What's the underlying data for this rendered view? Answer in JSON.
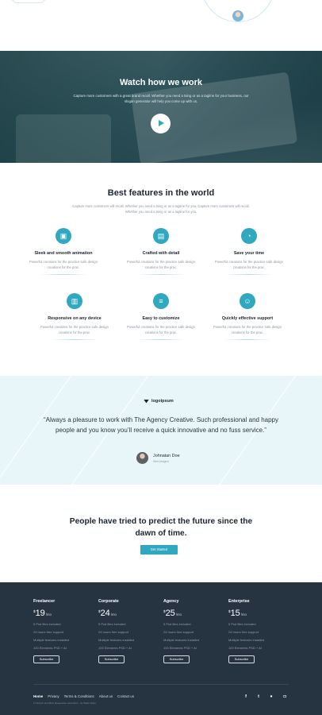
{
  "video": {
    "title": "Watch how we work",
    "subtitle": "Capture more customers with a great brand recall. Whether you need a tsing or as a tagline for your business, our slogan generator will help you come up with us."
  },
  "features": {
    "title": "Best features in the world",
    "subtitle": "Capture more customers will recall. Whether you need a tsing or as a tagline for you. Capture more customers will recall. Whether you need a tsing or as a tagline for you.",
    "items": [
      {
        "title": "Sleek and smooth animation",
        "desc": "Powerful creations for the practice safe design creations for the prac."
      },
      {
        "title": "Crafted with detail",
        "desc": "Powerful creations for the practice safe design creations for the prac."
      },
      {
        "title": "Save your time",
        "desc": "Powerful creations for the practice safe design creations for the prac."
      },
      {
        "title": "Responsive on any device",
        "desc": "Powerful creations for the practice safe design creations for the prac."
      },
      {
        "title": "Easy to customize",
        "desc": "Powerful creations for the practice safe design creations for the prac."
      },
      {
        "title": "Quickly effective support",
        "desc": "Powerful creations for the practice safe design creations for the prac."
      }
    ]
  },
  "testimonial": {
    "logo": "logoipsum",
    "quote": "“Always a pleasure to work with The Agency Creative. Such professional and happy people and you know you’ll receive a quick innovative and no fuss service.”",
    "author_name": "Johnatan Doe",
    "author_role": "Web Designer"
  },
  "cta": {
    "title": "People have tried to predict the future since the dawn of time.",
    "button": "Get Started"
  },
  "pricing": [
    {
      "name": "Freelancer",
      "currency": "$",
      "amount": "19",
      "period": "/mo",
      "features": [
        "5 Psd files included",
        "24 hours free support",
        "Multiple features installed",
        "100 Elements PSD + AI"
      ],
      "button": "Subscribe"
    },
    {
      "name": "Corporate",
      "currency": "$",
      "amount": "24",
      "period": "/mo",
      "features": [
        "5 Psd files included",
        "24 hours free support",
        "Multiple features installed",
        "100 Elements PSD + AI"
      ],
      "button": "Subscribe"
    },
    {
      "name": "Agency",
      "currency": "$",
      "amount": "25",
      "period": "/mo",
      "features": [
        "5 Psd files included",
        "24 hours free support",
        "Multiple features installed",
        "100 Elements PSD + AI"
      ],
      "button": "Subscribe"
    },
    {
      "name": "Enterprise",
      "currency": "$",
      "amount": "15",
      "period": "/mo",
      "features": [
        "5 Psd files included",
        "24 hours free support",
        "Multiple features installed",
        "100 Elements PSD + AI"
      ],
      "button": "Subscribe"
    }
  ],
  "footer": {
    "nav": [
      "Home",
      "Privacy",
      "Terms & Conditions",
      "About us",
      "Contact us"
    ],
    "copyright": "© Fintech Ltd 2019, Respective ownership - by Webb Team",
    "social": [
      {
        "icon": "facebook-icon",
        "glyph": "f"
      },
      {
        "icon": "twitter-icon",
        "glyph": "t"
      },
      {
        "icon": "whatsapp-icon",
        "glyph": "●"
      },
      {
        "icon": "instagram-icon",
        "glyph": "◘"
      }
    ]
  },
  "colors": {
    "accent": "#2fa8c0",
    "footer_bg": "#263340",
    "testimonial_bg": "#e9f6f9"
  }
}
